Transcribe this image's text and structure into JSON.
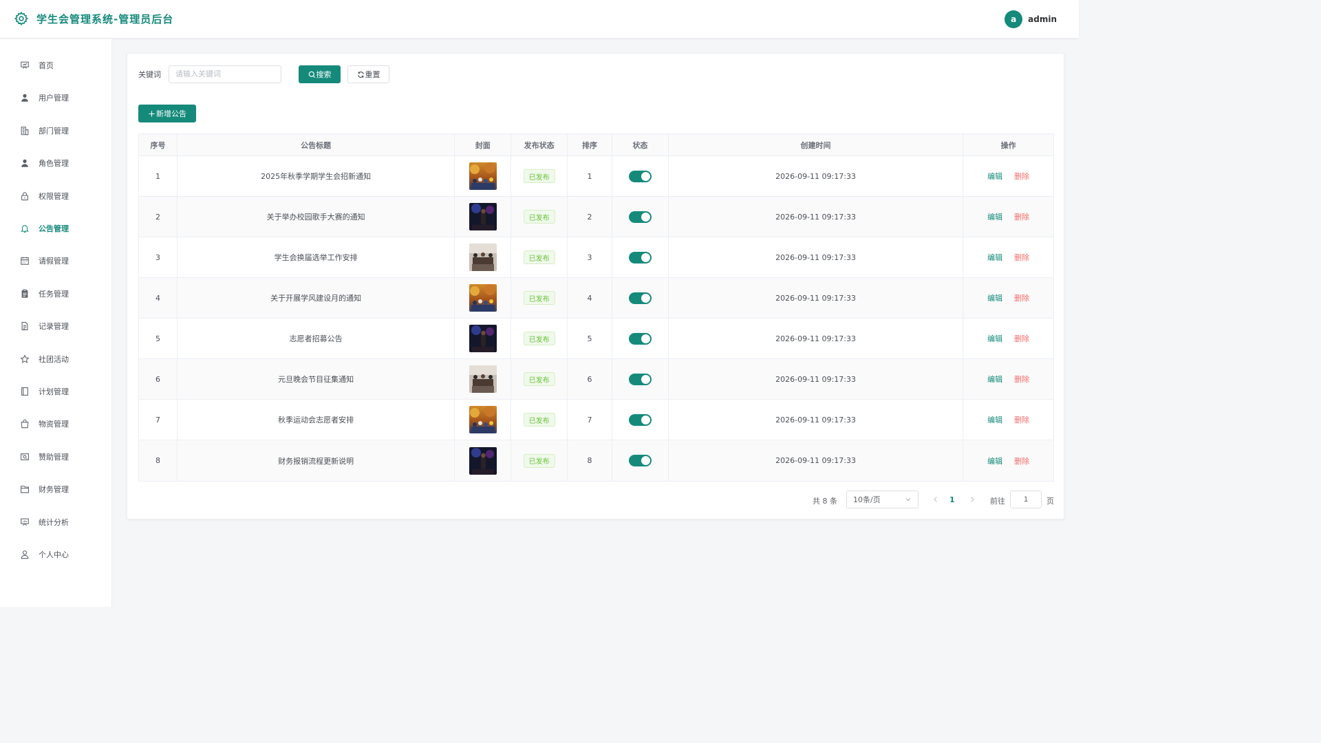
{
  "header": {
    "title": "学生会管理系统-管理员后台",
    "avatar_letter": "a",
    "username": "admin"
  },
  "sidebar": {
    "active_index": 5,
    "items": [
      {
        "label": "首页",
        "icon": "presentation-icon"
      },
      {
        "label": "用户管理",
        "icon": "user-icon"
      },
      {
        "label": "部门管理",
        "icon": "building-icon"
      },
      {
        "label": "角色管理",
        "icon": "user-icon"
      },
      {
        "label": "权限管理",
        "icon": "lock-icon"
      },
      {
        "label": "公告管理",
        "icon": "bell-icon"
      },
      {
        "label": "请假管理",
        "icon": "calendar-icon"
      },
      {
        "label": "任务管理",
        "icon": "clipboard-icon"
      },
      {
        "label": "记录管理",
        "icon": "document-icon"
      },
      {
        "label": "社团活动",
        "icon": "star-icon"
      },
      {
        "label": "计划管理",
        "icon": "notebook-icon"
      },
      {
        "label": "物资管理",
        "icon": "bag-icon"
      },
      {
        "label": "赞助管理",
        "icon": "money-icon"
      },
      {
        "label": "财务管理",
        "icon": "folder-icon"
      },
      {
        "label": "统计分析",
        "icon": "chart-board-icon"
      },
      {
        "label": "个人中心",
        "icon": "user-outline-icon"
      }
    ]
  },
  "search": {
    "label": "关键词",
    "placeholder": "请输入关键词",
    "search_label": "搜索",
    "reset_label": "重置"
  },
  "toolbar": {
    "add_label": "新增公告"
  },
  "table": {
    "columns": [
      "序号",
      "公告标题",
      "封面",
      "发布状态",
      "排序",
      "状态",
      "创建时间",
      "操作"
    ],
    "edit_label": "编辑",
    "delete_label": "删除",
    "rows": [
      {
        "no": "1",
        "title": "2025年秋季学期学生会招新通知",
        "cover": "autumn-crowd",
        "status": "已发布",
        "sort": "1",
        "enabled": true,
        "created": "2026-09-11 09:17:33"
      },
      {
        "no": "2",
        "title": "关于举办校园歌手大赛的通知",
        "cover": "stage-concert",
        "status": "已发布",
        "sort": "2",
        "enabled": true,
        "created": "2026-09-11 09:17:33"
      },
      {
        "no": "3",
        "title": "学生会换届选举工作安排",
        "cover": "meeting-room",
        "status": "已发布",
        "sort": "3",
        "enabled": true,
        "created": "2026-09-11 09:17:33"
      },
      {
        "no": "4",
        "title": "关于开展学风建设月的通知",
        "cover": "autumn-crowd",
        "status": "已发布",
        "sort": "4",
        "enabled": true,
        "created": "2026-09-11 09:17:33"
      },
      {
        "no": "5",
        "title": "志愿者招募公告",
        "cover": "stage-concert",
        "status": "已发布",
        "sort": "5",
        "enabled": true,
        "created": "2026-09-11 09:17:33"
      },
      {
        "no": "6",
        "title": "元旦晚会节目征集通知",
        "cover": "meeting-room",
        "status": "已发布",
        "sort": "6",
        "enabled": true,
        "created": "2026-09-11 09:17:33"
      },
      {
        "no": "7",
        "title": "秋季运动会志愿者安排",
        "cover": "autumn-crowd",
        "status": "已发布",
        "sort": "7",
        "enabled": true,
        "created": "2026-09-11 09:17:33"
      },
      {
        "no": "8",
        "title": "财务报销流程更新说明",
        "cover": "stage-concert",
        "status": "已发布",
        "sort": "8",
        "enabled": true,
        "created": "2026-09-11 09:17:33"
      }
    ]
  },
  "pagination": {
    "total_text": "共 8 条",
    "page_size": "10条/页",
    "current_page": "1",
    "goto_label": "前往",
    "goto_value": "1",
    "goto_suffix": "页"
  },
  "colors": {
    "primary": "#158a7b",
    "danger": "#f56c6c",
    "success": "#67c23a"
  }
}
